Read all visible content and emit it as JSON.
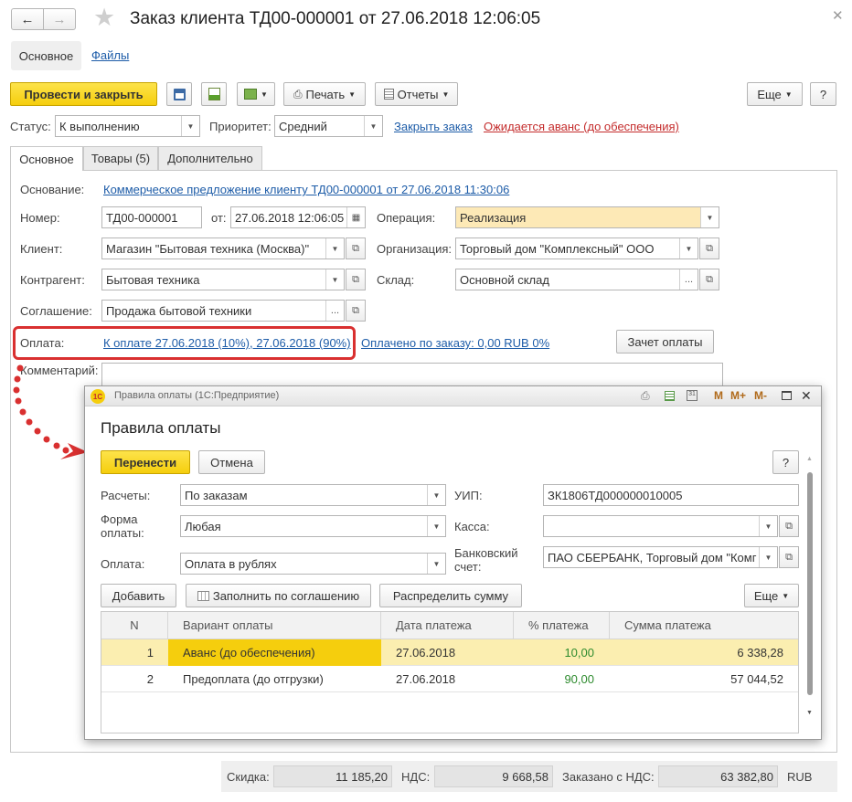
{
  "window": {
    "title": "Заказ клиента ТД00-000001 от 27.06.2018 12:06:05",
    "nav_tabs": [
      "Основное",
      "Файлы"
    ]
  },
  "toolbar": {
    "post_close": "Провести и закрыть",
    "print": "Печать",
    "reports": "Отчеты",
    "more": "Еще",
    "help": "?"
  },
  "status_row": {
    "status_label": "Статус:",
    "status_value": "К выполнению",
    "priority_label": "Приоритет:",
    "priority_value": "Средний",
    "close_order": "Закрыть заказ",
    "awaiting": "Ожидается аванс (до обеспечения)"
  },
  "tabs": [
    "Основное",
    "Товары (5)",
    "Дополнительно"
  ],
  "form": {
    "basis_label": "Основание:",
    "basis_value": "Коммерческое предложение клиенту ТД00-000001 от 27.06.2018 11:30:06",
    "number_label": "Номер:",
    "number_value": "ТД00-000001",
    "from_label": "от:",
    "date_value": "27.06.2018 12:06:05",
    "operation_label": "Операция:",
    "operation_value": "Реализация",
    "client_label": "Клиент:",
    "client_value": "Магазин \"Бытовая техника (Москва)\"",
    "org_label": "Организация:",
    "org_value": "Торговый дом \"Комплексный\" ООО",
    "contractor_label": "Контрагент:",
    "contractor_value": "Бытовая техника",
    "warehouse_label": "Склад:",
    "warehouse_value": "Основной склад",
    "agreement_label": "Соглашение:",
    "agreement_value": "Продажа бытовой техники",
    "payment_label": "Оплата:",
    "payment_link": "К оплате 27.06.2018 (10%), 27.06.2018 (90%)",
    "paid_link": "Оплачено по заказу: 0,00 RUB  0%",
    "offset_btn": "Зачет оплаты",
    "comment_label": "Комментарий:"
  },
  "footer": {
    "discount_label": "Скидка:",
    "discount_value": "11 185,20",
    "vat_label": "НДС:",
    "vat_value": "9 668,58",
    "ordered_label": "Заказано с НДС:",
    "ordered_value": "63 382,80",
    "currency": "RUB"
  },
  "dialog": {
    "window_title": "Правила оплаты  (1С:Предприятие)",
    "heading": "Правила оплаты",
    "transfer": "Перенести",
    "cancel": "Отмена",
    "help": "?",
    "settlements_label": "Расчеты:",
    "settlements_value": "По заказам",
    "uip_label": "УИП:",
    "uip_value": "ЗК1806ТД000000010005",
    "form_label": "Форма оплаты:",
    "form_value": "Любая",
    "cash_label": "Касса:",
    "cash_value": "",
    "payment_label": "Оплата:",
    "payment_value": "Оплата в рублях",
    "bank_label": "Банковский счет:",
    "bank_value": "ПАО СБЕРБАНК, Торговый дом \"Комг",
    "add": "Добавить",
    "fill": "Заполнить по соглашению",
    "distribute": "Распределить сумму",
    "more": "Еще",
    "table": {
      "columns": [
        "N",
        "Вариант оплаты",
        "Дата платежа",
        "% платежа",
        "Сумма платежа"
      ],
      "rows": [
        {
          "n": "1",
          "variant": "Аванс (до обеспечения)",
          "date": "27.06.2018",
          "percent": "10,00",
          "sum": "6 338,28"
        },
        {
          "n": "2",
          "variant": "Предоплата (до отгрузки)",
          "date": "27.06.2018",
          "percent": "90,00",
          "sum": "57 044,52"
        }
      ]
    }
  },
  "colors": {
    "accent_yellow": "#f5ce0d",
    "link_blue": "#1d5ca8",
    "highlight_red": "#d93030",
    "percent_green": "#2e8b2e",
    "selected_row": "#fbeeb0"
  }
}
